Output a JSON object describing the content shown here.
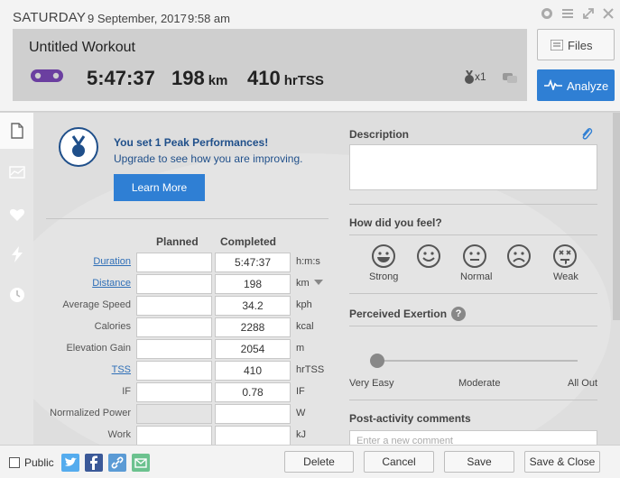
{
  "header": {
    "day": "SATURDAY",
    "date": "9 September, 2017",
    "time": "9:58 am",
    "workout_title": "Untitled Workout",
    "duration": "5:47:37",
    "distance_value": "198",
    "distance_unit": "km",
    "tss_value": "410",
    "tss_unit": "hrTSS",
    "medal_count": "x1",
    "files_label": "Files",
    "analyze_label": "Analyze"
  },
  "peak": {
    "title": "You set 1 Peak Performances!",
    "subtitle": "Upgrade to see how you are improving.",
    "button": "Learn More"
  },
  "table": {
    "col_planned": "Planned",
    "col_completed": "Completed",
    "rows": [
      {
        "label": "Duration",
        "planned": "",
        "completed": "5:47:37",
        "unit": "h:m:s"
      },
      {
        "label": "Distance",
        "planned": "",
        "completed": "198",
        "unit": "km"
      },
      {
        "label": "Average Speed",
        "planned": "",
        "completed": "34.2",
        "unit": "kph"
      },
      {
        "label": "Calories",
        "planned": "",
        "completed": "2288",
        "unit": "kcal"
      },
      {
        "label": "Elevation Gain",
        "planned": "",
        "completed": "2054",
        "unit": "m"
      },
      {
        "label": "TSS",
        "planned": "",
        "completed": "410",
        "unit": "hrTSS"
      },
      {
        "label": "IF",
        "planned": "",
        "completed": "0.78",
        "unit": "IF"
      },
      {
        "label": "Normalized Power",
        "planned": "",
        "completed": "",
        "unit": "W"
      },
      {
        "label": "Work",
        "planned": "",
        "completed": "",
        "unit": "kJ"
      }
    ]
  },
  "right": {
    "description_label": "Description",
    "feel_label": "How did you feel?",
    "feel_options": [
      "Strong",
      "Normal",
      "Weak"
    ],
    "exertion_label": "Perceived Exertion",
    "exertion_help": "?",
    "exertion_scale": [
      "Very Easy",
      "Moderate",
      "All Out"
    ],
    "exertion_value": 0,
    "comments_label": "Post-activity comments",
    "comment_placeholder": "Enter a new comment"
  },
  "footer": {
    "public_label": "Public",
    "delete": "Delete",
    "cancel": "Cancel",
    "save": "Save",
    "save_close": "Save & Close"
  },
  "colors": {
    "accent": "#2f7fd4",
    "bike_icon": "#6b3fa0",
    "link": "#2f6fb7",
    "twitter": "#55acee",
    "facebook": "#3b5998",
    "link_share": "#5b9bd5",
    "email_share": "#6cc28f"
  }
}
